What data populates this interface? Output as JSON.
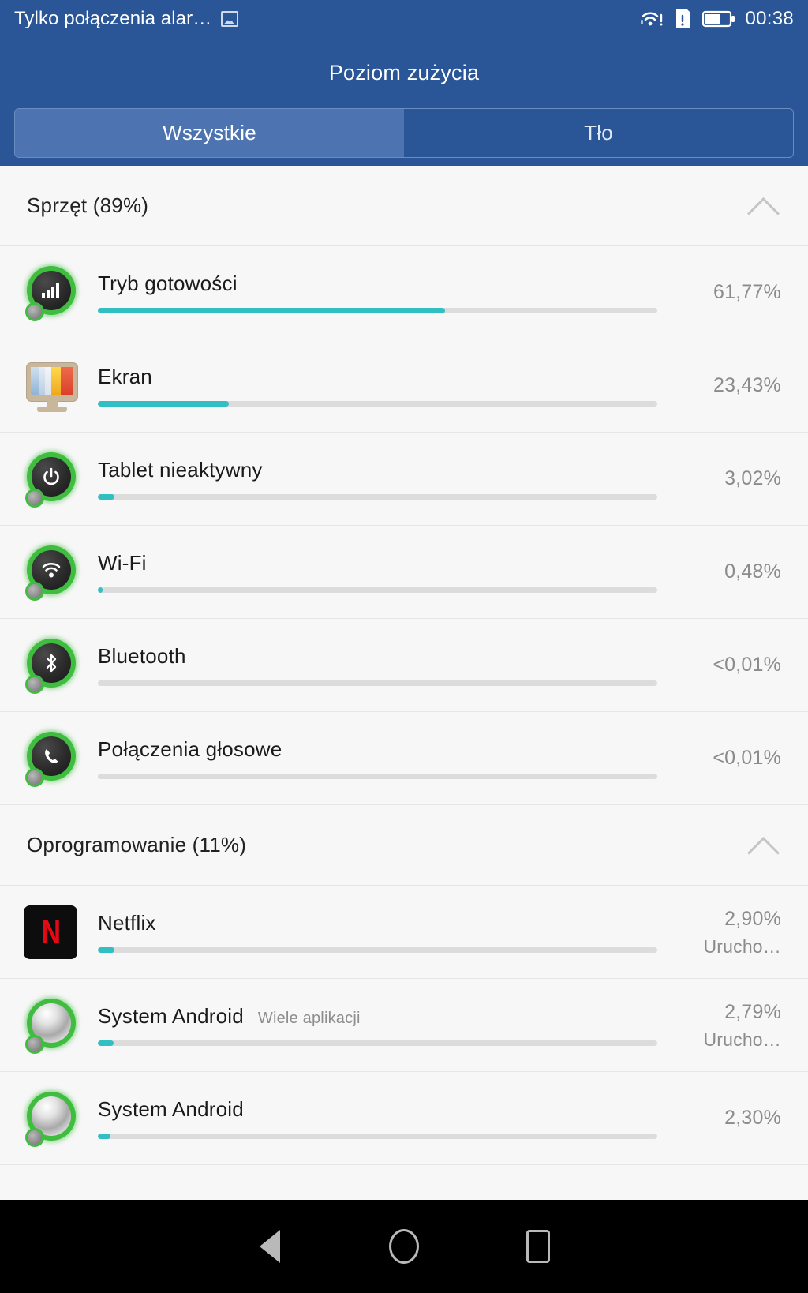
{
  "statusbar": {
    "carrier": "Tylko połączenia alar…",
    "time": "00:38",
    "icons": [
      "screenshot-icon",
      "wifi-alert-icon",
      "sim-alert-icon",
      "battery-icon"
    ],
    "background": "#2a5597"
  },
  "appbar": {
    "title": "Poziom zużycia"
  },
  "tabs": [
    {
      "label": "Wszystkie",
      "active": true
    },
    {
      "label": "Tło",
      "active": false
    }
  ],
  "sections": [
    {
      "title": "Sprzęt (89%)",
      "expanded": true,
      "rows": [
        {
          "icon": "signal-bars-icon",
          "title": "Tryb gotowości",
          "subtitle": "",
          "percent": "61,77%",
          "fill": 62.0,
          "status": ""
        },
        {
          "icon": "monitor-icon",
          "title": "Ekran",
          "subtitle": "",
          "percent": "23,43%",
          "fill": 23.4,
          "status": ""
        },
        {
          "icon": "power-icon",
          "title": "Tablet nieaktywny",
          "subtitle": "",
          "percent": "3,02%",
          "fill": 3.0,
          "status": ""
        },
        {
          "icon": "wifi-icon",
          "title": "Wi-Fi",
          "subtitle": "",
          "percent": "0,48%",
          "fill": 0.8,
          "status": ""
        },
        {
          "icon": "bluetooth-icon",
          "title": "Bluetooth",
          "subtitle": "",
          "percent": "<0,01%",
          "fill": 0.0,
          "status": ""
        },
        {
          "icon": "phone-icon",
          "title": "Połączenia głosowe",
          "subtitle": "",
          "percent": "<0,01%",
          "fill": 0.0,
          "status": ""
        }
      ]
    },
    {
      "title": "Oprogramowanie (11%)",
      "expanded": true,
      "rows": [
        {
          "icon": "netflix-icon",
          "title": "Netflix",
          "subtitle": "",
          "percent": "2,90%",
          "fill": 2.9,
          "status": "Urucho…"
        },
        {
          "icon": "android-system-icon",
          "title": "System Android",
          "subtitle": "Wiele aplikacji",
          "percent": "2,79%",
          "fill": 2.8,
          "status": "Urucho…"
        },
        {
          "icon": "android-system-icon",
          "title": "System Android",
          "subtitle": "",
          "percent": "2,30%",
          "fill": 2.3,
          "status": ""
        }
      ]
    }
  ],
  "navbar": {
    "back_label": "back-button",
    "home_label": "home-button",
    "recents_label": "recents-button"
  },
  "colors": {
    "header": "#2a5597",
    "tab_active": "#4d74b0",
    "progress_fill": "#31bfc4",
    "progress_track": "#dcdcdc",
    "list_bg": "#f7f7f7"
  }
}
